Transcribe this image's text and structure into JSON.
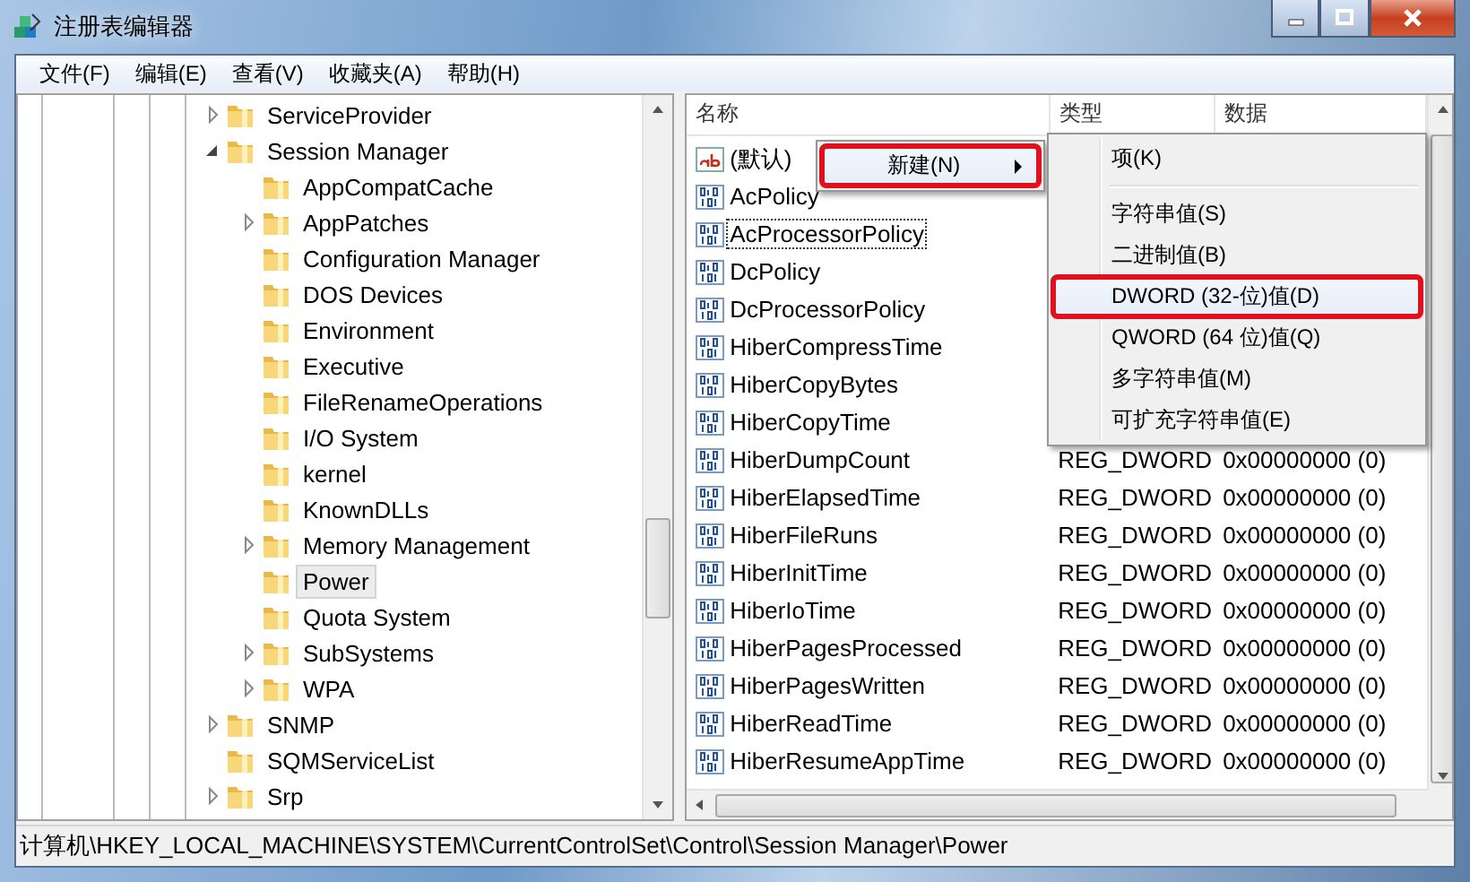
{
  "window": {
    "title": "注册表编辑器"
  },
  "menu_bar": [
    "文件(F)",
    "编辑(E)",
    "查看(V)",
    "收藏夹(A)",
    "帮助(H)"
  ],
  "tree": {
    "items": [
      {
        "label": "ServiceProvider",
        "expandable": true,
        "expanded": false,
        "selected": false
      },
      {
        "label": "Session Manager",
        "expandable": true,
        "expanded": true,
        "selected": false,
        "children": [
          {
            "label": "AppCompatCache",
            "expandable": false,
            "expanded": false,
            "selected": false
          },
          {
            "label": "AppPatches",
            "expandable": true,
            "expanded": false,
            "selected": false
          },
          {
            "label": "Configuration Manager",
            "expandable": false,
            "expanded": false,
            "selected": false
          },
          {
            "label": "DOS Devices",
            "expandable": false,
            "expanded": false,
            "selected": false
          },
          {
            "label": "Environment",
            "expandable": false,
            "expanded": false,
            "selected": false
          },
          {
            "label": "Executive",
            "expandable": false,
            "expanded": false,
            "selected": false
          },
          {
            "label": "FileRenameOperations",
            "expandable": false,
            "expanded": false,
            "selected": false
          },
          {
            "label": "I/O System",
            "expandable": false,
            "expanded": false,
            "selected": false
          },
          {
            "label": "kernel",
            "expandable": false,
            "expanded": false,
            "selected": false
          },
          {
            "label": "KnownDLLs",
            "expandable": false,
            "expanded": false,
            "selected": false
          },
          {
            "label": "Memory Management",
            "expandable": true,
            "expanded": false,
            "selected": false
          },
          {
            "label": "Power",
            "expandable": false,
            "expanded": false,
            "selected": true
          },
          {
            "label": "Quota System",
            "expandable": false,
            "expanded": false,
            "selected": false
          },
          {
            "label": "SubSystems",
            "expandable": true,
            "expanded": false,
            "selected": false
          },
          {
            "label": "WPA",
            "expandable": true,
            "expanded": false,
            "selected": false
          }
        ]
      },
      {
        "label": "SNMP",
        "expandable": true,
        "expanded": false,
        "selected": false
      },
      {
        "label": "SQMServiceList",
        "expandable": false,
        "expanded": false,
        "selected": false
      },
      {
        "label": "Srp",
        "expandable": true,
        "expanded": false,
        "selected": false
      }
    ]
  },
  "list": {
    "columns": [
      "名称",
      "类型",
      "数据"
    ],
    "rows": [
      {
        "kind": "string",
        "name": "(默认)",
        "focused": false
      },
      {
        "kind": "dword",
        "name": "AcPolicy",
        "focused": false
      },
      {
        "kind": "dword",
        "name": "AcProcessorPolicy",
        "focused": true
      },
      {
        "kind": "dword",
        "name": "DcPolicy",
        "focused": false
      },
      {
        "kind": "dword",
        "name": "DcProcessorPolicy",
        "focused": false
      },
      {
        "kind": "dword",
        "name": "HiberCompressTime",
        "focused": false
      },
      {
        "kind": "dword",
        "name": "HiberCopyBytes",
        "focused": false
      },
      {
        "kind": "dword",
        "name": "HiberCopyTime",
        "focused": false
      },
      {
        "kind": "dword",
        "name": "HiberDumpCount",
        "type": "REG_DWORD",
        "data": "0x00000000 (0)",
        "focused": false
      },
      {
        "kind": "dword",
        "name": "HiberElapsedTime",
        "type": "REG_DWORD",
        "data": "0x00000000 (0)",
        "focused": false
      },
      {
        "kind": "dword",
        "name": "HiberFileRuns",
        "type": "REG_DWORD",
        "data": "0x00000000 (0)",
        "focused": false
      },
      {
        "kind": "dword",
        "name": "HiberInitTime",
        "type": "REG_DWORD",
        "data": "0x00000000 (0)",
        "focused": false
      },
      {
        "kind": "dword",
        "name": "HiberIoTime",
        "type": "REG_DWORD",
        "data": "0x00000000 (0)",
        "focused": false
      },
      {
        "kind": "dword",
        "name": "HiberPagesProcessed",
        "type": "REG_DWORD",
        "data": "0x00000000 (0)",
        "focused": false
      },
      {
        "kind": "dword",
        "name": "HiberPagesWritten",
        "type": "REG_DWORD",
        "data": "0x00000000 (0)",
        "focused": false
      },
      {
        "kind": "dword",
        "name": "HiberReadTime",
        "type": "REG_DWORD",
        "data": "0x00000000 (0)",
        "focused": false
      },
      {
        "kind": "dword",
        "name": "HiberResumeAppTime",
        "type": "REG_DWORD",
        "data": "0x00000000 (0)",
        "focused": false
      }
    ]
  },
  "context_menu": {
    "items": [
      {
        "label": "新建(N)",
        "has_submenu": true,
        "highlighted": true,
        "marked": true
      }
    ]
  },
  "submenu": {
    "items": [
      {
        "kind": "item",
        "label": "项(K)",
        "highlighted": false,
        "marked": false
      },
      {
        "kind": "separator"
      },
      {
        "kind": "item",
        "label": "字符串值(S)",
        "highlighted": false,
        "marked": false
      },
      {
        "kind": "item",
        "label": "二进制值(B)",
        "highlighted": false,
        "marked": false
      },
      {
        "kind": "item",
        "label": "DWORD (32-位)值(D)",
        "highlighted": true,
        "marked": true
      },
      {
        "kind": "item",
        "label": "QWORD (64 位)值(Q)",
        "highlighted": false,
        "marked": false
      },
      {
        "kind": "item",
        "label": "多字符串值(M)",
        "highlighted": false,
        "marked": false
      },
      {
        "kind": "item",
        "label": "可扩充字符串值(E)",
        "highlighted": false,
        "marked": false
      }
    ]
  },
  "status_bar": {
    "path": "计算机\\HKEY_LOCAL_MACHINE\\SYSTEM\\CurrentControlSet\\Control\\Session Manager\\Power"
  }
}
